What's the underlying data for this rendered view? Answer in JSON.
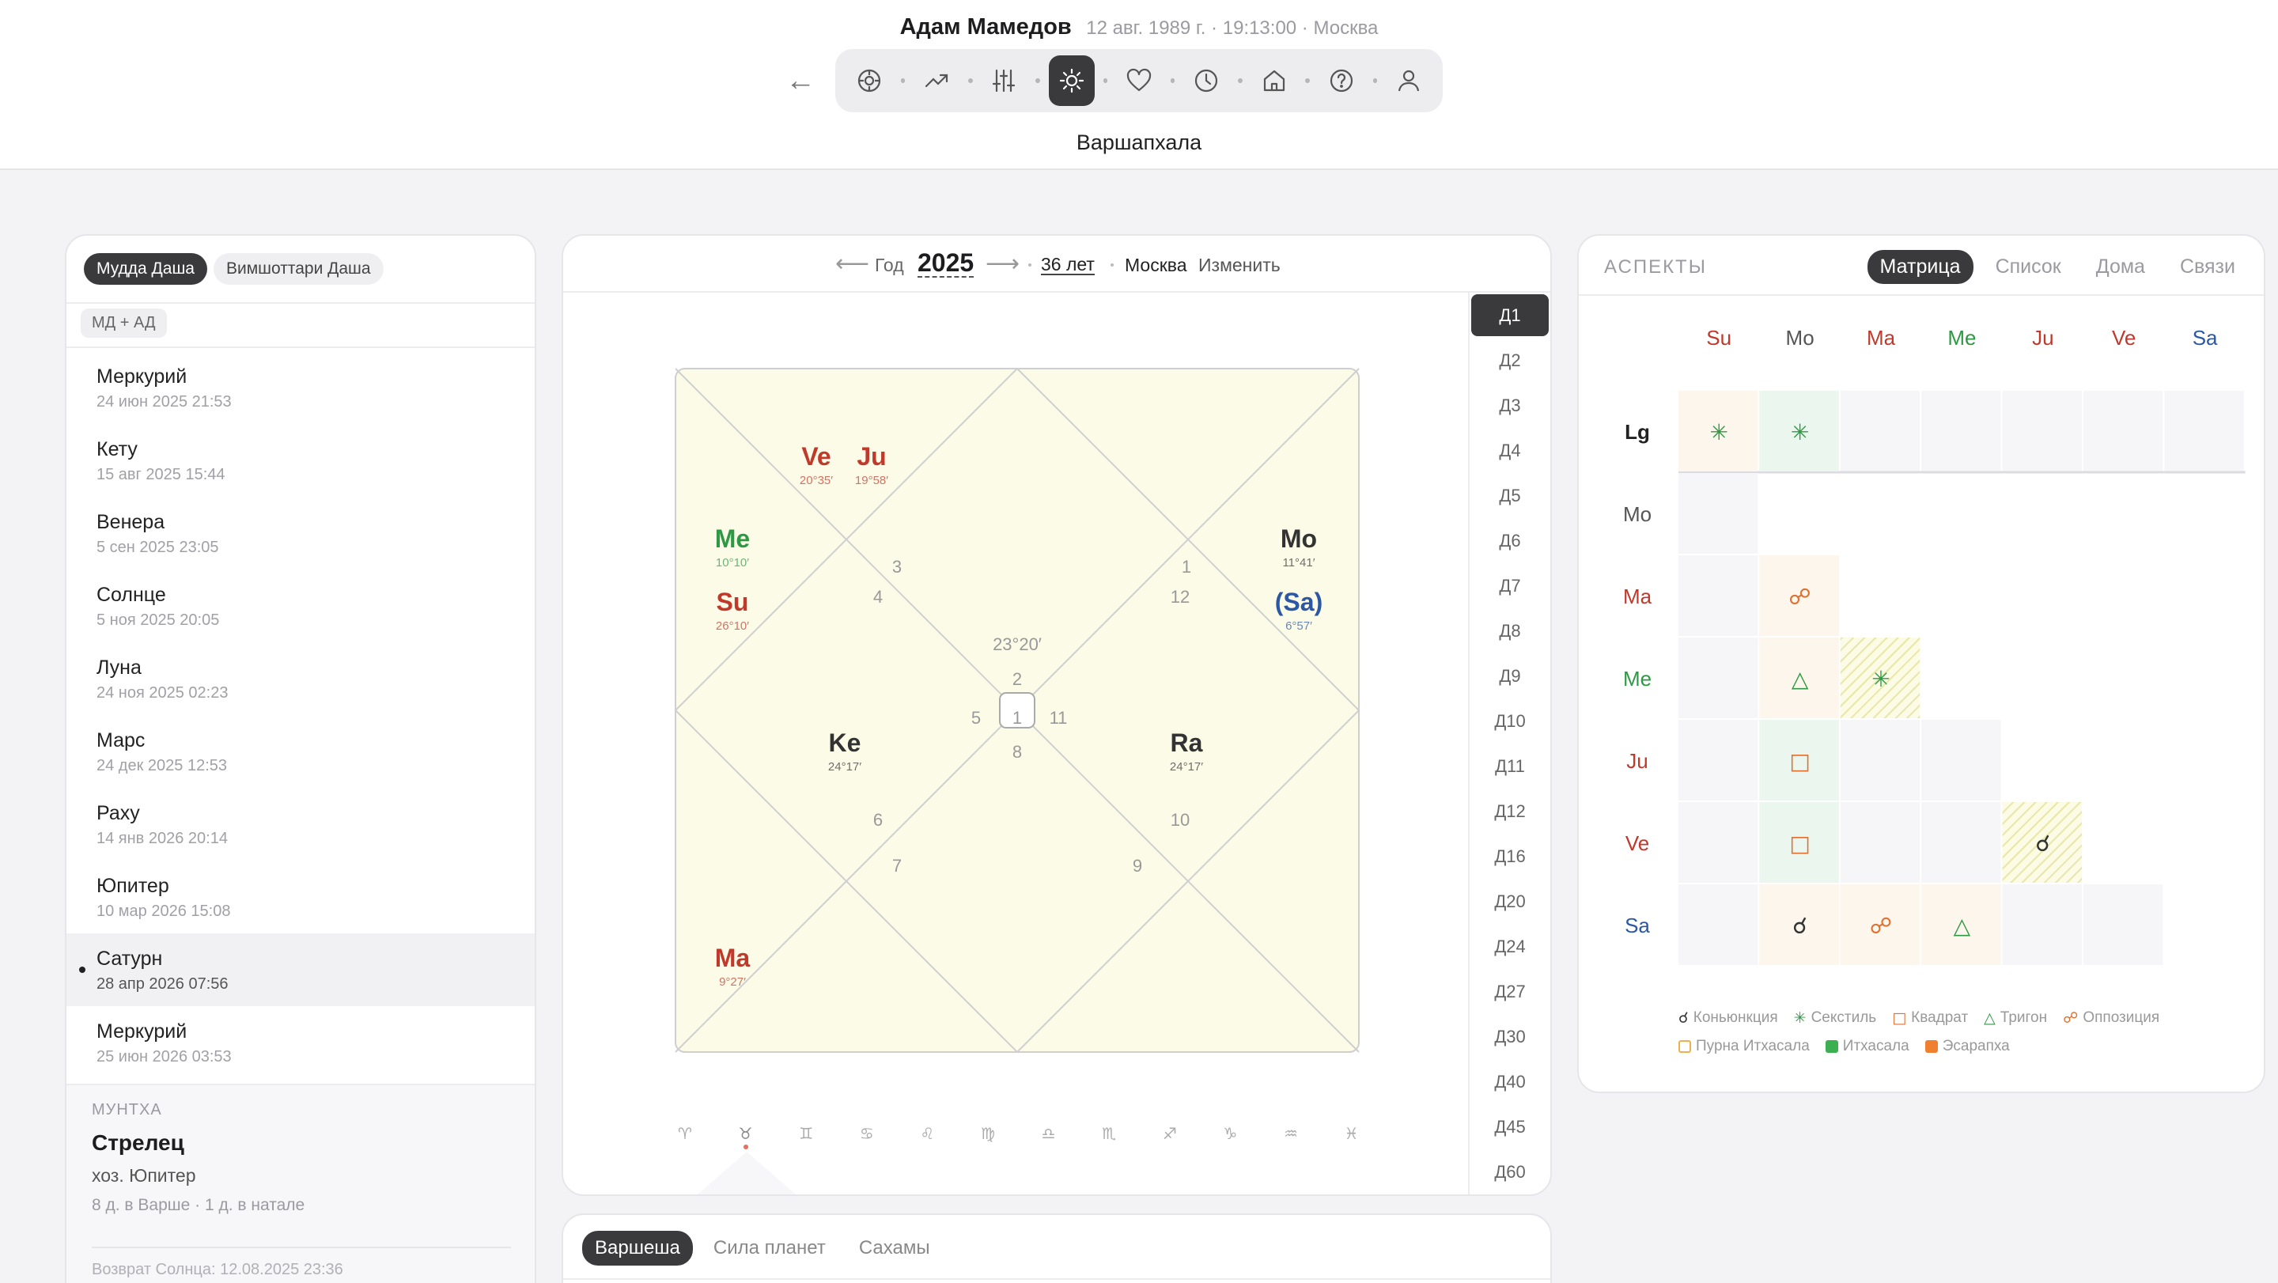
{
  "header": {
    "person_name": "Адам Мамедов",
    "birth_meta": "12 авг. 1989 г. · 19:13:00 · Москва",
    "subtitle": "Варшапхала",
    "back_glyph": "←",
    "toolbar_icons": [
      "compass-icon",
      "trend-icon",
      "sliders-icon",
      "sun-icon",
      "heart-icon",
      "clock-icon",
      "home-icon",
      "help-icon",
      "user-icon"
    ]
  },
  "left": {
    "tabs": [
      "Мудда Даша",
      "Вимшоттари Даша"
    ],
    "tag": "МД + АД",
    "dashas": [
      {
        "name": "Меркурий",
        "date": "24 июн 2025 21:53"
      },
      {
        "name": "Кету",
        "date": "15 авг 2025 15:44"
      },
      {
        "name": "Венера",
        "date": "5 сен 2025 23:05"
      },
      {
        "name": "Солнце",
        "date": "5 ноя 2025 20:05"
      },
      {
        "name": "Луна",
        "date": "24 ноя 2025 02:23"
      },
      {
        "name": "Марс",
        "date": "24 дек 2025 12:53"
      },
      {
        "name": "Раху",
        "date": "14 янв 2026 20:14"
      },
      {
        "name": "Юпитер",
        "date": "10 мар 2026 15:08"
      },
      {
        "name": "Сатурн",
        "date": "28 апр 2026 07:56",
        "current": true
      },
      {
        "name": "Меркурий",
        "date": "25 июн 2026 03:53"
      }
    ],
    "muntha": {
      "label": "МУНТХА",
      "sign": "Стрелец",
      "lord": "хоз. Юпитер",
      "days": "8 д. в Варше · 1 д. в натале",
      "solar_return": "Возврат Солнца: 12.08.2025 23:36"
    }
  },
  "center": {
    "year_label": "Год",
    "year": "2025",
    "arrow_left": "⟵",
    "arrow_right": "⟶",
    "age": "36 лет",
    "city": "Москва",
    "change": "Изменить",
    "divisions": [
      "Д1",
      "Д2",
      "Д3",
      "Д4",
      "Д5",
      "Д6",
      "Д7",
      "Д8",
      "Д9",
      "Д10",
      "Д11",
      "Д12",
      "Д16",
      "Д20",
      "Д24",
      "Д27",
      "Д30",
      "Д40",
      "Д45",
      "Д60"
    ],
    "asc_degree": "23°20′",
    "house_numbers": [
      "1",
      "2",
      "3",
      "4",
      "5",
      "6",
      "7",
      "8",
      "9",
      "10",
      "11",
      "12"
    ],
    "planets": [
      {
        "abbr": "Ve",
        "deg": "20°35′",
        "color": "#c0392b"
      },
      {
        "abbr": "Ju",
        "deg": "19°58′",
        "color": "#c0392b"
      },
      {
        "abbr": "Me",
        "deg": "10°10′",
        "color": "#2e9944"
      },
      {
        "abbr": "Su",
        "deg": "26°10′",
        "color": "#c0392b"
      },
      {
        "abbr": "Mo",
        "deg": "11°41′",
        "color": "#333333"
      },
      {
        "abbr": "(Sa)",
        "deg": "6°57′",
        "color": "#2b57a5"
      },
      {
        "abbr": "Ke",
        "deg": "24°17′",
        "color": "#333333"
      },
      {
        "abbr": "Ra",
        "deg": "24°17′",
        "color": "#333333"
      },
      {
        "abbr": "Ma",
        "deg": "9°27′",
        "color": "#c0392b"
      }
    ],
    "zodiac": [
      "♈",
      "♉",
      "♊",
      "♋",
      "♌",
      "♍",
      "♎",
      "♏",
      "♐",
      "♑",
      "♒",
      "♓"
    ],
    "bottom_tabs": [
      "Варшеша",
      "Сила планет",
      "Сахамы"
    ]
  },
  "aspects": {
    "title": "АСПЕКТЫ",
    "tabs": [
      "Матрица",
      "Список",
      "Дома",
      "Связи"
    ],
    "columns": [
      {
        "abbr": "Su",
        "color": "#c0392b"
      },
      {
        "abbr": "Mo",
        "color": "#555555"
      },
      {
        "abbr": "Ma",
        "color": "#c0392b"
      },
      {
        "abbr": "Me",
        "color": "#2e9944"
      },
      {
        "abbr": "Ju",
        "color": "#c0392b"
      },
      {
        "abbr": "Ve",
        "color": "#c0392b"
      },
      {
        "abbr": "Sa",
        "color": "#2b57a5"
      }
    ],
    "rows": [
      {
        "abbr": "Lg",
        "color": "#222222"
      },
      {
        "abbr": "Mo",
        "color": "#555555"
      },
      {
        "abbr": "Ma",
        "color": "#c0392b"
      },
      {
        "abbr": "Me",
        "color": "#2e9944"
      },
      {
        "abbr": "Ju",
        "color": "#c0392b"
      },
      {
        "abbr": "Ve",
        "color": "#c0392b"
      },
      {
        "abbr": "Sa",
        "color": "#2b57a5"
      }
    ],
    "cells": [
      {
        "row": 0,
        "col": 0,
        "glyph": "✳",
        "glyph_color": "#2e9944",
        "bg": "#fdf6ec"
      },
      {
        "row": 0,
        "col": 1,
        "glyph": "✳",
        "glyph_color": "#2e9944",
        "bg": "#eaf6ee"
      },
      {
        "row": 2,
        "col": 1,
        "glyph": "☍",
        "glyph_color": "#e07030",
        "bg": "#fdf6ec"
      },
      {
        "row": 3,
        "col": 1,
        "glyph": "△",
        "glyph_color": "#2e9944",
        "bg": "#fdf6ec"
      },
      {
        "row": 3,
        "col": 2,
        "glyph": "✳",
        "glyph_color": "#2e9944",
        "bg": "hatch"
      },
      {
        "row": 4,
        "col": 1,
        "glyph": "□",
        "glyph_color": "#e07030",
        "bg": "#eaf6ee"
      },
      {
        "row": 5,
        "col": 1,
        "glyph": "□",
        "glyph_color": "#e07030",
        "bg": "#eaf6ee"
      },
      {
        "row": 5,
        "col": 4,
        "glyph": "☌",
        "glyph_color": "#333333",
        "bg": "hatch"
      },
      {
        "row": 6,
        "col": 1,
        "glyph": "☌",
        "glyph_color": "#333333",
        "bg": "#fdf6ec"
      },
      {
        "row": 6,
        "col": 2,
        "glyph": "☍",
        "glyph_color": "#e07030",
        "bg": "#fdf6ec"
      },
      {
        "row": 6,
        "col": 3,
        "glyph": "△",
        "glyph_color": "#2e9944",
        "bg": "#fdf6ec"
      }
    ],
    "legend_row1": [
      {
        "glyph": "☌",
        "label": "Коньюнкция",
        "color": "#333333"
      },
      {
        "glyph": "✳",
        "label": "Секстиль",
        "color": "#2e9944"
      },
      {
        "glyph": "□",
        "label": "Квадрат",
        "color": "#e07030"
      },
      {
        "glyph": "△",
        "label": "Тригон",
        "color": "#2e9944"
      },
      {
        "glyph": "☍",
        "label": "Оппозиция",
        "color": "#e07030"
      }
    ],
    "legend_row2": [
      {
        "label": "Пурна Итхасала",
        "color": "#f0b050",
        "outline": true
      },
      {
        "label": "Итхасала",
        "color": "#3cb050"
      },
      {
        "label": "Эсарапха",
        "color": "#f08030"
      }
    ]
  }
}
